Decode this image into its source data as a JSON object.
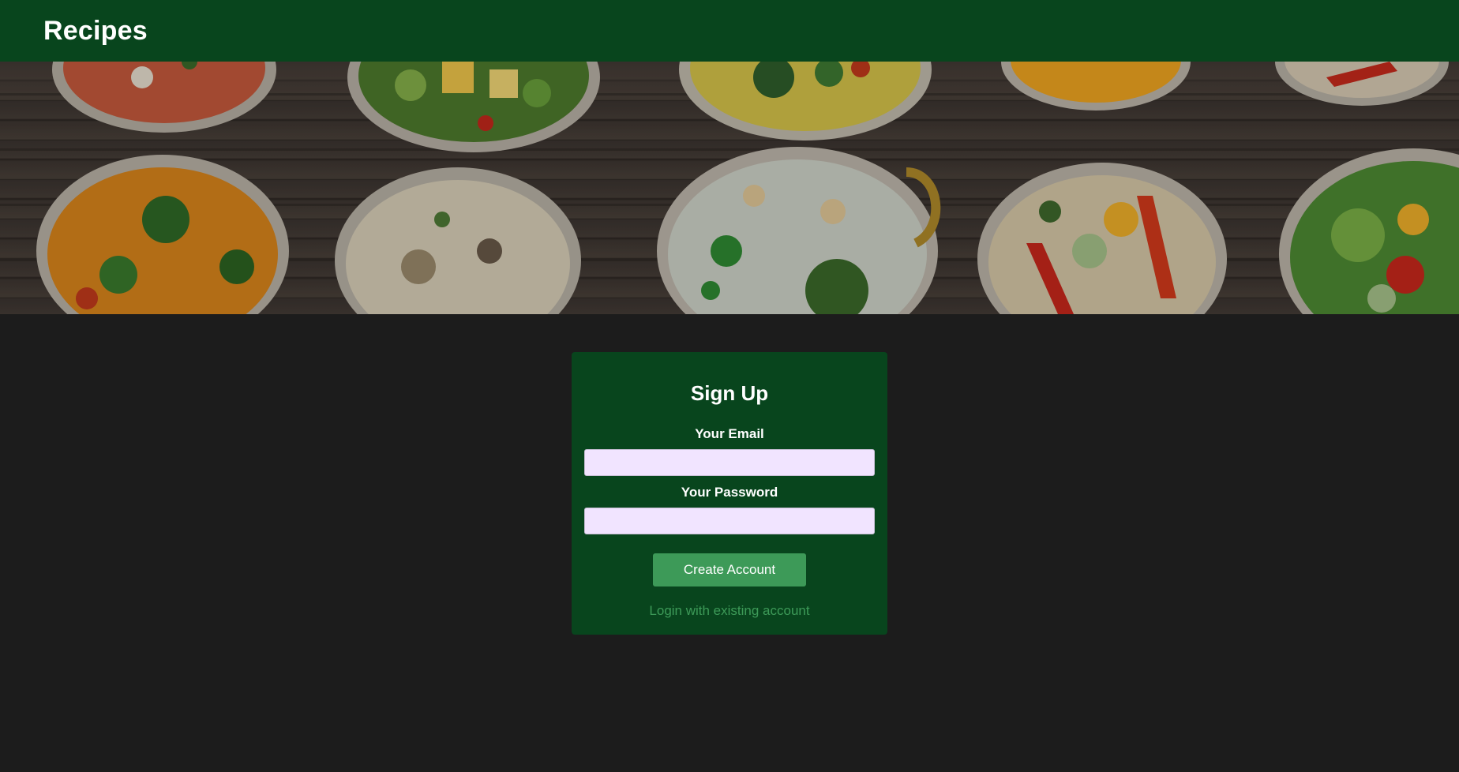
{
  "app": {
    "brand": "Recipes"
  },
  "colors": {
    "navbar": "#08451d",
    "page_background": "#1c1c1c",
    "card": "#08451d",
    "button": "#3d9a58",
    "link": "#3d9a58",
    "input_background": "#f1e4ff"
  },
  "hero": {
    "image": "food-bowls-banner"
  },
  "signup": {
    "title": "Sign Up",
    "email_label": "Your Email",
    "email_value": "",
    "email_placeholder": "",
    "password_label": "Your Password",
    "password_value": "",
    "password_placeholder": "",
    "submit_label": "Create Account",
    "login_link": "Login with existing account"
  }
}
